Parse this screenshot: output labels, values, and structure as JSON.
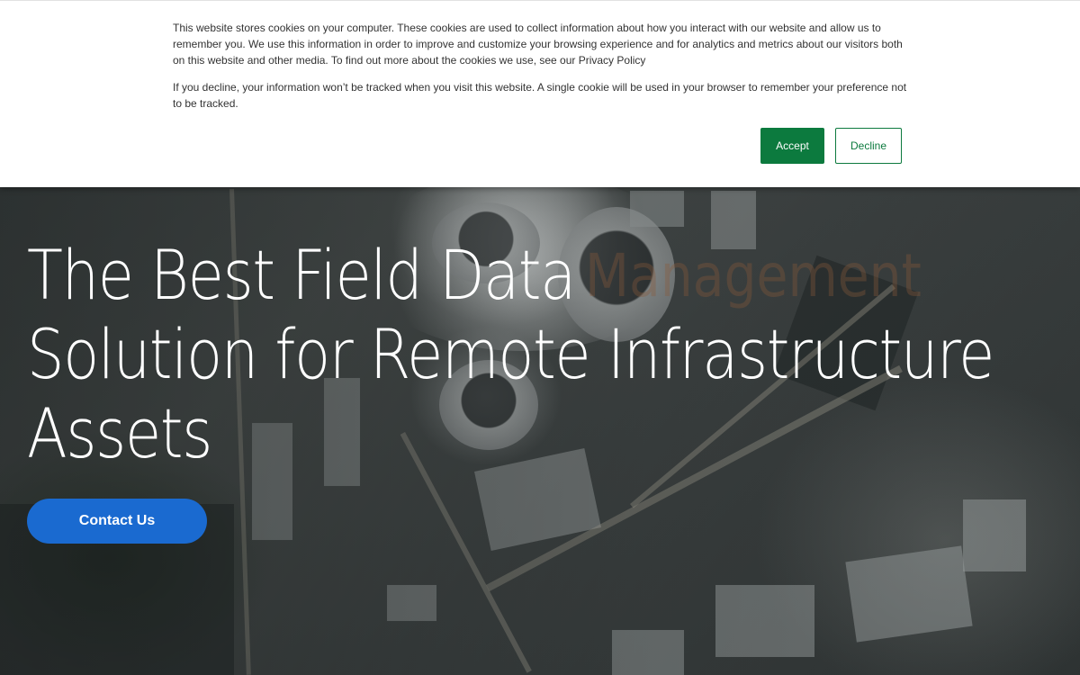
{
  "cookie_banner": {
    "paragraph_1": "This website stores cookies on your computer. These cookies are used to collect information about how you interact with our website and allow us to remember you. We use this information in order to improve and customize your browsing experience and for analytics and metrics about our visitors both on this website and other media. To find out more about the cookies we use, see our Privacy Policy",
    "paragraph_2": "If you decline, your information won’t be tracked when you visit this website. A single cookie will be used in your browser to remember your preference not to be tracked.",
    "accept_label": "Accept",
    "decline_label": "Decline",
    "accent_color": "#0c7a3e"
  },
  "hero": {
    "headline_lines": [
      "The Best Field Data",
      "Solution for Remote Infrastructure",
      "Assets"
    ],
    "ghost_word": "Management",
    "cta_label": "Contact Us",
    "cta_color": "#1a6ad0"
  }
}
